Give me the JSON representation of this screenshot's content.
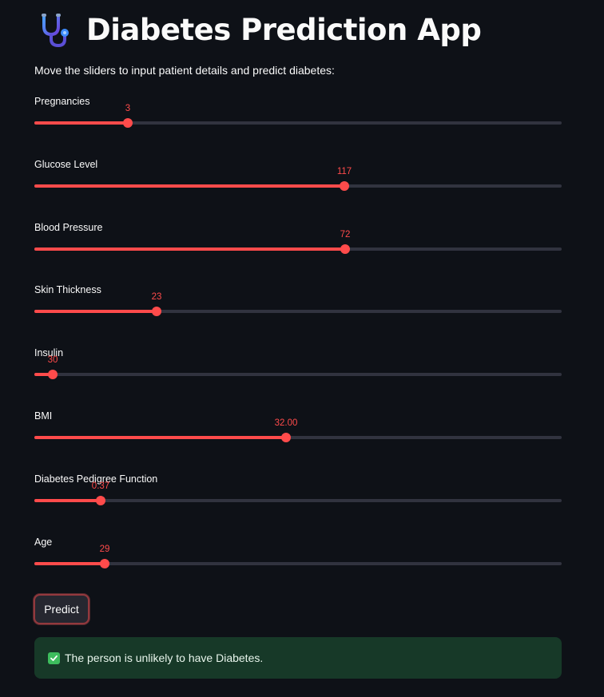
{
  "app": {
    "title": "Diabetes Prediction App",
    "icon": "stethoscope-icon",
    "intro": "Move the sliders to input patient details and predict diabetes:"
  },
  "colors": {
    "background": "#0e1117",
    "accent": "#ff4b4b",
    "track": "#31333f",
    "success_bg": "#173928",
    "success_icon": "#3dbd5d"
  },
  "sliders": [
    {
      "label": "Pregnancies",
      "value": "3",
      "fraction": 0.177
    },
    {
      "label": "Glucose Level",
      "value": "117",
      "fraction": 0.588
    },
    {
      "label": "Blood Pressure",
      "value": "72",
      "fraction": 0.59
    },
    {
      "label": "Skin Thickness",
      "value": "23",
      "fraction": 0.232
    },
    {
      "label": "Insulin",
      "value": "30",
      "fraction": 0.035
    },
    {
      "label": "BMI",
      "value": "32.00",
      "fraction": 0.477
    },
    {
      "label": "Diabetes Pedigree Function",
      "value": "0.37",
      "fraction": 0.125
    },
    {
      "label": "Age",
      "value": "29",
      "fraction": 0.133
    }
  ],
  "predict_button": {
    "label": "Predict"
  },
  "result": {
    "icon": "check-icon",
    "text": "The person is unlikely to have Diabetes."
  }
}
